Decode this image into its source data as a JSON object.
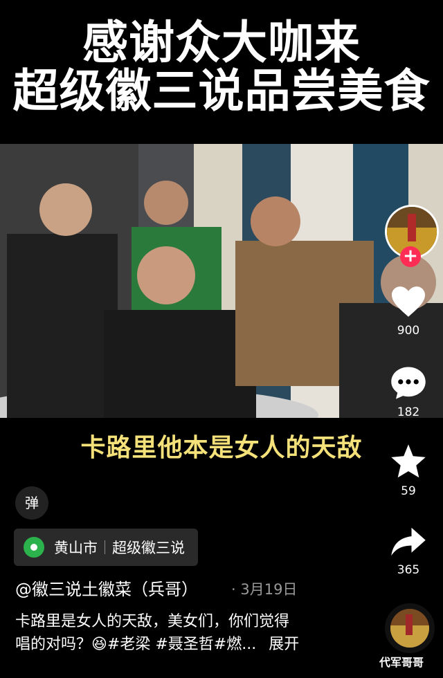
{
  "header": {
    "title_line1": "感谢众大咖来",
    "title_line2": "超级徽三说品尝美食"
  },
  "video": {
    "caption": "卡路里他本是女人的天敌"
  },
  "controls": {
    "danmu_label": "弹"
  },
  "location": {
    "city": "黄山市",
    "place": "超级徽三说"
  },
  "post": {
    "author": "@徽三说土徽菜（兵哥）",
    "date": "· 3月19日",
    "text_line1": "卡路里是女人的天敌，美女们，你们觉得",
    "text_line2": "唱的对吗？😆#老梁 #聂圣哲#燃...",
    "expand": "展开"
  },
  "actions": {
    "likes": "900",
    "comments": "182",
    "favorites": "59",
    "shares": "365",
    "follow_plus": "+"
  },
  "watermark": "代军哥哥",
  "colors": {
    "caption": "#f5e17a",
    "follow": "#ff2c55",
    "pin": "#2bb24c"
  }
}
